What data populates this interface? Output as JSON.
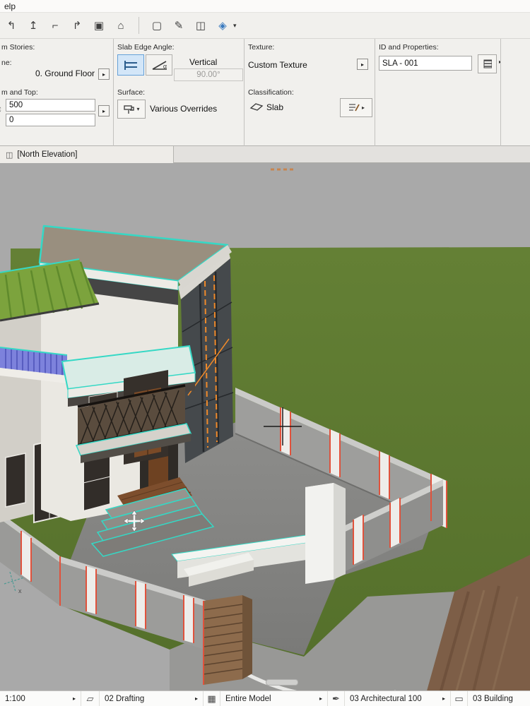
{
  "colors": {
    "selection_cyan": "#35d8c5",
    "selection_orange": "#f08a2a",
    "edge_red": "#e0523c",
    "grass_green": "#5d7831",
    "viewport_bg": "#a9a9a9",
    "toolbar_bg": "#f1f0ed",
    "selected_button_bg": "#d3e6f8"
  },
  "menubar": {
    "visible_text": "elp"
  },
  "toolbar": {
    "icons": [
      {
        "name": "trim-icon",
        "glyph": "↰"
      },
      {
        "name": "adjust-icon",
        "glyph": "↥"
      },
      {
        "name": "corner-icon",
        "glyph": "⌐"
      },
      {
        "name": "extend-icon",
        "glyph": "↱"
      },
      {
        "name": "resize-icon",
        "glyph": "▣"
      },
      {
        "name": "home-icon",
        "glyph": "⌂"
      },
      {
        "name": "marquee-icon",
        "glyph": "▢"
      },
      {
        "name": "pick-up-parameters-icon",
        "glyph": "✎"
      },
      {
        "name": "inject-parameters-icon",
        "glyph": "◫"
      },
      {
        "name": "surface-paint-icon",
        "glyph": "◈"
      }
    ],
    "dropdown_arrow": "▾"
  },
  "ui": {
    "arrow_right": "▸",
    "dropdown_arrow": "▾"
  },
  "infobox": {
    "stories": {
      "label_top": "m Stories:",
      "label_mid": "ne:",
      "value": "0. Ground Floor"
    },
    "offsets": {
      "label": "m and Top:",
      "top_value": "500",
      "bottom_value": "0",
      "stub_glyph": "↕"
    },
    "slab_edge": {
      "label": "Slab Edge Angle:",
      "mode": "Vertical",
      "angle_value": "90.00°",
      "alpha": "α"
    },
    "surface": {
      "label": "Surface:",
      "value": "Various Overrides"
    },
    "texture": {
      "label": "Texture:",
      "value": "Custom Texture"
    },
    "classification": {
      "label": "Classification:",
      "value": "Slab"
    },
    "id_properties": {
      "label": "ID and Properties:",
      "value": "SLA - 001"
    }
  },
  "tabbar": {
    "active_tab": "[North Elevation]",
    "icon_glyph": "◫"
  },
  "viewport": {
    "axis_label": "x"
  },
  "statusbar": {
    "scale": "1:100",
    "layers_icon": "▱",
    "layer_combination": "02 Drafting",
    "model_filter_icon": "▦",
    "model_filter": "Entire Model",
    "pen_set_icon": "✒",
    "pen_set": "03 Architectural 100",
    "layout_icon": "▭",
    "layout_book": "03 Building"
  }
}
